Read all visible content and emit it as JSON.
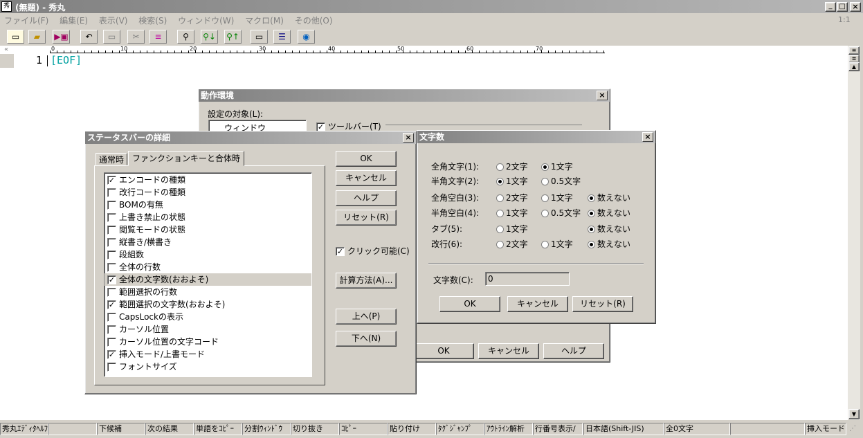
{
  "app": {
    "title": "(無題) - 秀丸",
    "position_indicator": "1:1",
    "menu": [
      "ファイル(F)",
      "編集(E)",
      "表示(V)",
      "検索(S)",
      "ウィンドウ(W)",
      "マクロ(M)",
      "その他(O)"
    ],
    "left_margin_glyph": "«"
  },
  "editor": {
    "line_number": "1",
    "eof_marker": "[EOF]",
    "ruler_labels": [
      "0",
      "10",
      "20",
      "30",
      "40",
      "50",
      "60",
      "70"
    ]
  },
  "toolbar_icons": [
    "new-file",
    "open-folder",
    "save",
    "undo",
    "copy-window",
    "cut",
    "paste-list",
    "find",
    "find-down",
    "find-up",
    "tag-window",
    "split-window",
    "help"
  ],
  "env_dialog": {
    "title": "動作環境",
    "target_label": "設定の対象(L):",
    "tree_item": "ウィンドウ",
    "toolbar_checkbox": "ツールバー(T)",
    "ok": "OK",
    "cancel": "キャンセル",
    "help": "ヘルプ"
  },
  "status_dialog": {
    "title": "ステータスバーの詳細",
    "tabs": [
      "通常時",
      "ファンクションキーと合体時"
    ],
    "items": [
      {
        "label": "エンコードの種類",
        "checked": true
      },
      {
        "label": "改行コードの種類",
        "checked": false
      },
      {
        "label": "BOMの有無",
        "checked": false
      },
      {
        "label": "上書き禁止の状態",
        "checked": false
      },
      {
        "label": "閲覧モードの状態",
        "checked": false
      },
      {
        "label": "縦書き/横書き",
        "checked": false
      },
      {
        "label": "段組数",
        "checked": false
      },
      {
        "label": "全体の行数",
        "checked": false
      },
      {
        "label": "全体の文字数(おおよそ)",
        "checked": true
      },
      {
        "label": "範囲選択の行数",
        "checked": false
      },
      {
        "label": "範囲選択の文字数(おおよそ)",
        "checked": true
      },
      {
        "label": "CapsLockの表示",
        "checked": false
      },
      {
        "label": "カーソル位置",
        "checked": false
      },
      {
        "label": "カーソル位置の文字コード",
        "checked": false
      },
      {
        "label": "挿入モード/上書モード",
        "checked": true
      },
      {
        "label": "フォントサイズ",
        "checked": false
      }
    ],
    "buttons": {
      "ok": "OK",
      "cancel": "キャンセル",
      "help": "ヘルプ",
      "reset": "リセット(R)",
      "clickable": "クリック可能(C)",
      "calc": "計算方法(A)...",
      "up": "上へ(P)",
      "down": "下へ(N)"
    }
  },
  "count_dialog": {
    "title": "文字数",
    "rows": [
      {
        "label": "全角文字(1):",
        "options": [
          {
            "text": "2文字",
            "on": false
          },
          {
            "text": "1文字",
            "on": true
          }
        ]
      },
      {
        "label": "半角文字(2):",
        "options": [
          {
            "text": "1文字",
            "on": true
          },
          {
            "text": "0.5文字",
            "on": false
          }
        ]
      },
      {
        "label": "全角空白(3):",
        "options": [
          {
            "text": "2文字",
            "on": false
          },
          {
            "text": "1文字",
            "on": false
          },
          {
            "text": "数えない",
            "on": true
          }
        ]
      },
      {
        "label": "半角空白(4):",
        "options": [
          {
            "text": "1文字",
            "on": false
          },
          {
            "text": "0.5文字",
            "on": false
          },
          {
            "text": "数えない",
            "on": true
          }
        ]
      },
      {
        "label": "タブ(5):",
        "options": [
          {
            "text": "1文字",
            "on": false
          },
          {
            "text": "",
            "on": false
          },
          {
            "text": "数えない",
            "on": true
          }
        ]
      },
      {
        "label": "改行(6):",
        "options": [
          {
            "text": "2文字",
            "on": false
          },
          {
            "text": "1文字",
            "on": false
          },
          {
            "text": "数えない",
            "on": true
          }
        ]
      }
    ],
    "count_label": "文字数(C):",
    "count_value": "0",
    "ok": "OK",
    "cancel": "キャンセル",
    "reset": "リセット(R)"
  },
  "statusbar": {
    "fkeys": [
      "秀丸ｴﾃﾞｨﾀﾍﾙﾌﾟ",
      "",
      "下候補",
      "次の結果",
      "単語をｺﾋﾟｰ",
      "分割ｳｨﾝﾄﾞｳ",
      "切り抜き",
      "ｺﾋﾟｰ",
      "貼り付け",
      "ﾀｸﾞｼﾞｬﾝﾌﾟ",
      "ｱｳﾄﾗｲﾝ解析",
      "行番号表示/"
    ],
    "encoding": "日本語(Shift-JIS)",
    "char_count": "全0文字",
    "mode": "挿入モード"
  }
}
